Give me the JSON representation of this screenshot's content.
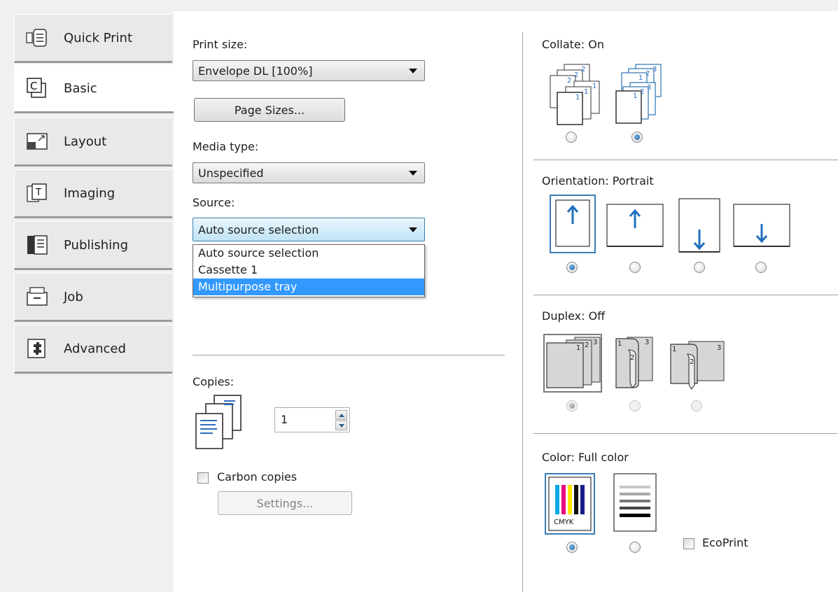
{
  "tabs": [
    {
      "label": "Quick Print",
      "icon": "quick-print-icon"
    },
    {
      "label": "Basic",
      "icon": "basic-icon"
    },
    {
      "label": "Layout",
      "icon": "layout-icon"
    },
    {
      "label": "Imaging",
      "icon": "imaging-icon"
    },
    {
      "label": "Publishing",
      "icon": "publishing-icon"
    },
    {
      "label": "Job",
      "icon": "job-icon"
    },
    {
      "label": "Advanced",
      "icon": "advanced-icon"
    }
  ],
  "active_tab": "Basic",
  "left": {
    "print_size_label": "Print size:",
    "print_size_value": "Envelope DL  [100%]",
    "page_sizes_button": "Page Sizes...",
    "media_type_label": "Media type:",
    "media_type_value": "Unspecified",
    "source_label": "Source:",
    "source_value": "Auto source selection",
    "source_options": [
      "Auto source selection",
      "Cassette 1",
      "Multipurpose tray"
    ],
    "source_highlighted": "Multipurpose tray",
    "copies_label": "Copies:",
    "copies_value": "1",
    "carbon_copies_label": "Carbon copies",
    "carbon_copies_checked": false,
    "settings_button": "Settings..."
  },
  "right": {
    "collate_label": "Collate:  On",
    "orientation_label": "Orientation:  Portrait",
    "duplex_label": "Duplex:  Off",
    "color_label": "Color:  Full color",
    "cmyk_text": "CMYK",
    "ecoprint_label": "EcoPrint",
    "ecoprint_checked": false
  },
  "colors": {
    "selection_frame": "#3a7db5",
    "dropdown_highlight": "#3399ff",
    "arrow_blue": "#1f6fc0"
  }
}
